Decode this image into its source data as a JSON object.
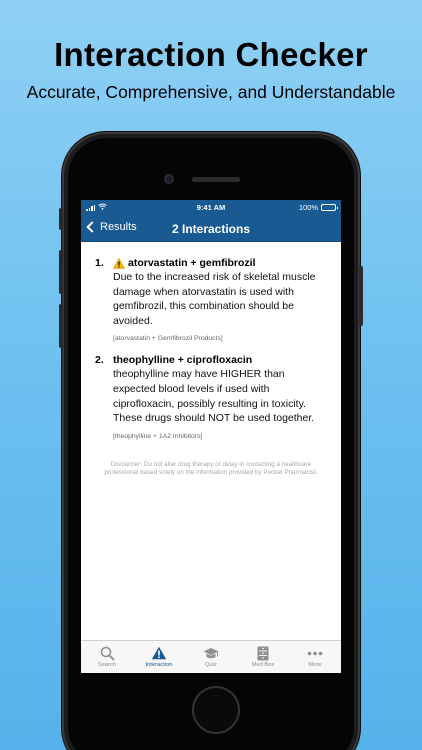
{
  "promo": {
    "headline": "Interaction Checker",
    "subhead": "Accurate, Comprehensive, and Understandable"
  },
  "status_bar": {
    "time": "9:41 AM",
    "battery": "100%"
  },
  "nav": {
    "back_label": "Results",
    "title": "2 Interactions"
  },
  "interactions": [
    {
      "number": "1.",
      "title": "atorvastatin + gemfibrozil",
      "has_warning_icon": true,
      "description": "Due to the increased risk of skeletal muscle damage when atorvastatin is used with gemfibrozil, this combination should be avoided.",
      "source": "[atorvastatin + Gemfibrozil Products]"
    },
    {
      "number": "2.",
      "title": "theophylline + ciprofloxacin",
      "has_warning_icon": false,
      "description": "theophylline may have HIGHER than expected blood levels if used with ciprofloxacin, possibly resulting in toxicity. These drugs should NOT be used together.",
      "source": "[theophylline + 1A2 Inhibitors]"
    }
  ],
  "disclaimer": "Disclaimer: Do not alter drug therapy or delay in contacting a healthcare professional based solely on the information provided by Pocket Pharmacist.",
  "tabs": [
    {
      "label": "Search",
      "icon": "search-icon",
      "active": false
    },
    {
      "label": "Interaction",
      "icon": "warning-icon",
      "active": true
    },
    {
      "label": "Quiz",
      "icon": "graduation-cap-icon",
      "active": false
    },
    {
      "label": "Med Box",
      "icon": "med-box-icon",
      "active": false
    },
    {
      "label": "More",
      "icon": "more-dots-icon",
      "active": false
    }
  ],
  "colors": {
    "background_top": "#8fd0f5",
    "background_bottom": "#55b2ea",
    "nav_bar": "#1a5a93",
    "active_tab": "#1a5a93",
    "inactive_tab": "#8e8e93",
    "warning": "#f5b800"
  }
}
